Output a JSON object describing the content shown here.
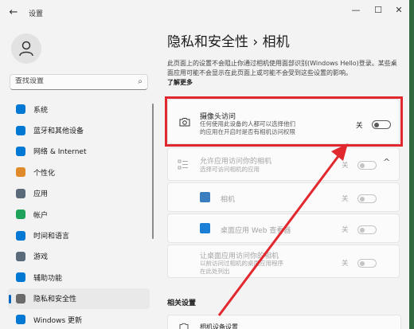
{
  "window": {
    "title": "设置",
    "back": "←",
    "minimize": "—",
    "maximize": "☐",
    "close": "✕"
  },
  "search": {
    "placeholder": "查找设置"
  },
  "nav": [
    {
      "label": "系统",
      "icon": "monitor-icon",
      "color": "#0078d4"
    },
    {
      "label": "蓝牙和其他设备",
      "icon": "bluetooth-icon",
      "color": "#0078d4"
    },
    {
      "label": "网络 & Internet",
      "icon": "wifi-icon",
      "color": "#0078d4"
    },
    {
      "label": "个性化",
      "icon": "brush-icon",
      "color": "#e08a2a"
    },
    {
      "label": "应用",
      "icon": "apps-icon",
      "color": "#5a6a7a"
    },
    {
      "label": "帐户",
      "icon": "account-icon",
      "color": "#1fa35b"
    },
    {
      "label": "时间和语言",
      "icon": "clock-globe-icon",
      "color": "#0078d4"
    },
    {
      "label": "游戏",
      "icon": "game-icon",
      "color": "#5a6a7a"
    },
    {
      "label": "辅助功能",
      "icon": "accessibility-icon",
      "color": "#0078d4"
    },
    {
      "label": "隐私和安全性",
      "icon": "shield-icon",
      "color": "#6a6a6a",
      "active": true
    },
    {
      "label": "Windows 更新",
      "icon": "update-icon",
      "color": "#0078d4"
    }
  ],
  "main": {
    "title": "隐私和安全性 › 相机",
    "description": "此页面上的设置不会阻止你通过相机使用面部识别(Windows Hello)登录。某些桌面应用可能不会显示在此页面上或可能不会受到这些设置的影响。",
    "learn_more": "了解更多",
    "camera_access": {
      "title": "摄像头访问",
      "subtitle_line1": "任何使用此设备的人都可以选择他们",
      "subtitle_line2": "的应用在开启时是否有相机访问权限",
      "state": "关"
    },
    "app_access": {
      "title": "允许应用访问你的相机",
      "subtitle": "选择可访问相机的应用",
      "state": "关",
      "chevron": "^"
    },
    "apps": [
      {
        "name": "相机",
        "state": "关"
      },
      {
        "name": "桌面应用 Web 查看器",
        "state": "关"
      }
    ],
    "desktop_access": {
      "title": "让桌面应用访问你的相机",
      "subtitle_line1": "以前访问过相机的桌面应用程序",
      "subtitle_line2": "在此处列出",
      "state": "关"
    },
    "related_heading": "相关设置",
    "related_row": "相机设备设置"
  },
  "colors": {
    "highlight": "#e0282e",
    "accent": "#0067c0"
  }
}
